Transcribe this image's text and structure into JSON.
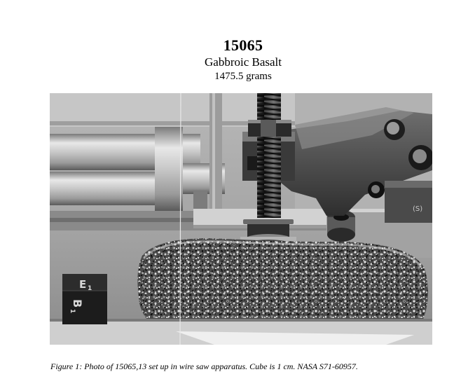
{
  "header": {
    "sample_number": "15065",
    "rock_type": "Gabbroic Basalt",
    "mass": "1475.5 grams"
  },
  "photo": {
    "cube_label_top": "E",
    "cube_label_top_sub": "1",
    "cube_label_side": "B",
    "cube_label_side_sub": "1",
    "clamp_marking": "(S)"
  },
  "figure": {
    "caption": "Figure 1:  Photo of 15065,13 set up in wire saw apparatus.  Cube is 1 cm.  NASA S71-60957."
  }
}
